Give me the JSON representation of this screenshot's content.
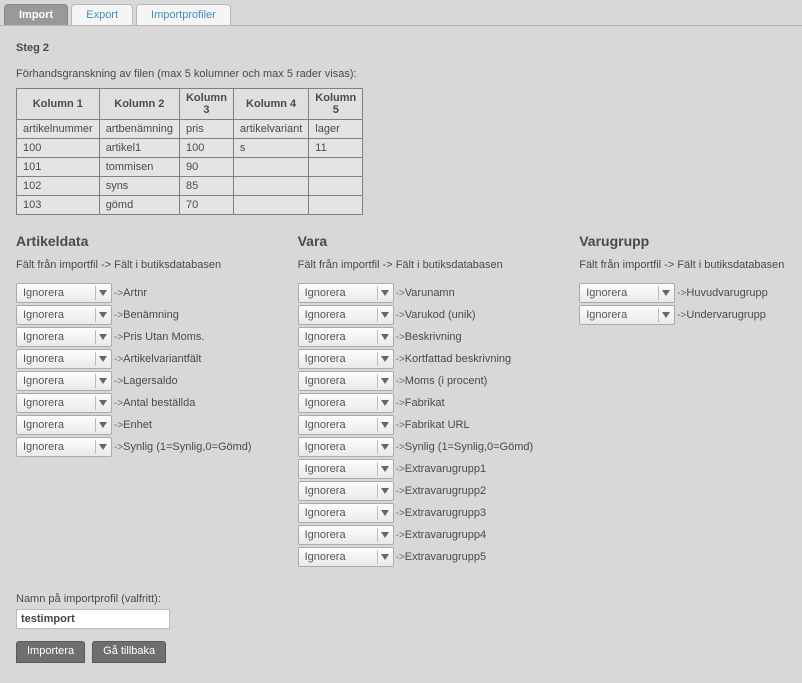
{
  "tabs": {
    "import": "Import",
    "export": "Export",
    "importprofiler": "Importprofiler"
  },
  "step_title": "Steg 2",
  "preview_note": "Förhandsgranskning av filen (max 5 kolumner och max 5 rader visas):",
  "preview_table": {
    "headers": [
      "Kolumn 1",
      "Kolumn 2",
      "Kolumn 3",
      "Kolumn 4",
      "Kolumn 5"
    ],
    "rows": [
      [
        "artikelnummer",
        "artbenämning",
        "pris",
        "artikelvariant",
        "lager"
      ],
      [
        "100",
        "artikel1",
        "100",
        "s",
        "11"
      ],
      [
        "101",
        "tommisen",
        "90",
        "",
        ""
      ],
      [
        "102",
        "syns",
        "85",
        "",
        ""
      ],
      [
        "103",
        "gömd",
        "70",
        "",
        ""
      ]
    ]
  },
  "labels": {
    "ignore": "Ignorera",
    "arrow": "->",
    "sub": "Fält från importfil -> Fält i butiksdatabasen"
  },
  "sections": {
    "artikeldata": {
      "title": "Artikeldata",
      "fields": [
        "Artnr",
        "Benämning",
        "Pris Utan Moms.",
        "Artikelvariantfält",
        "Lagersaldo",
        "Antal beställda",
        "Enhet",
        "Synlig (1=Synlig,0=Gömd)"
      ]
    },
    "vara": {
      "title": "Vara",
      "fields": [
        "Varunamn",
        "Varukod (unik)",
        "Beskrivning",
        "Kortfattad beskrivning",
        "Moms (i procent)",
        "Fabrikat",
        "Fabrikat URL",
        "Synlig (1=Synlig,0=Gömd)",
        "Extravarugrupp1",
        "Extravarugrupp2",
        "Extravarugrupp3",
        "Extravarugrupp4",
        "Extravarugrupp5"
      ]
    },
    "varugrupp": {
      "title": "Varugrupp",
      "fields": [
        "Huvudvarugrupp",
        "Undervarugrupp"
      ]
    }
  },
  "profile_name_label": "Namn på importprofil (valfritt):",
  "profile_name_value": "testimport",
  "buttons": {
    "import": "Importera",
    "back": "Gå tillbaka"
  }
}
